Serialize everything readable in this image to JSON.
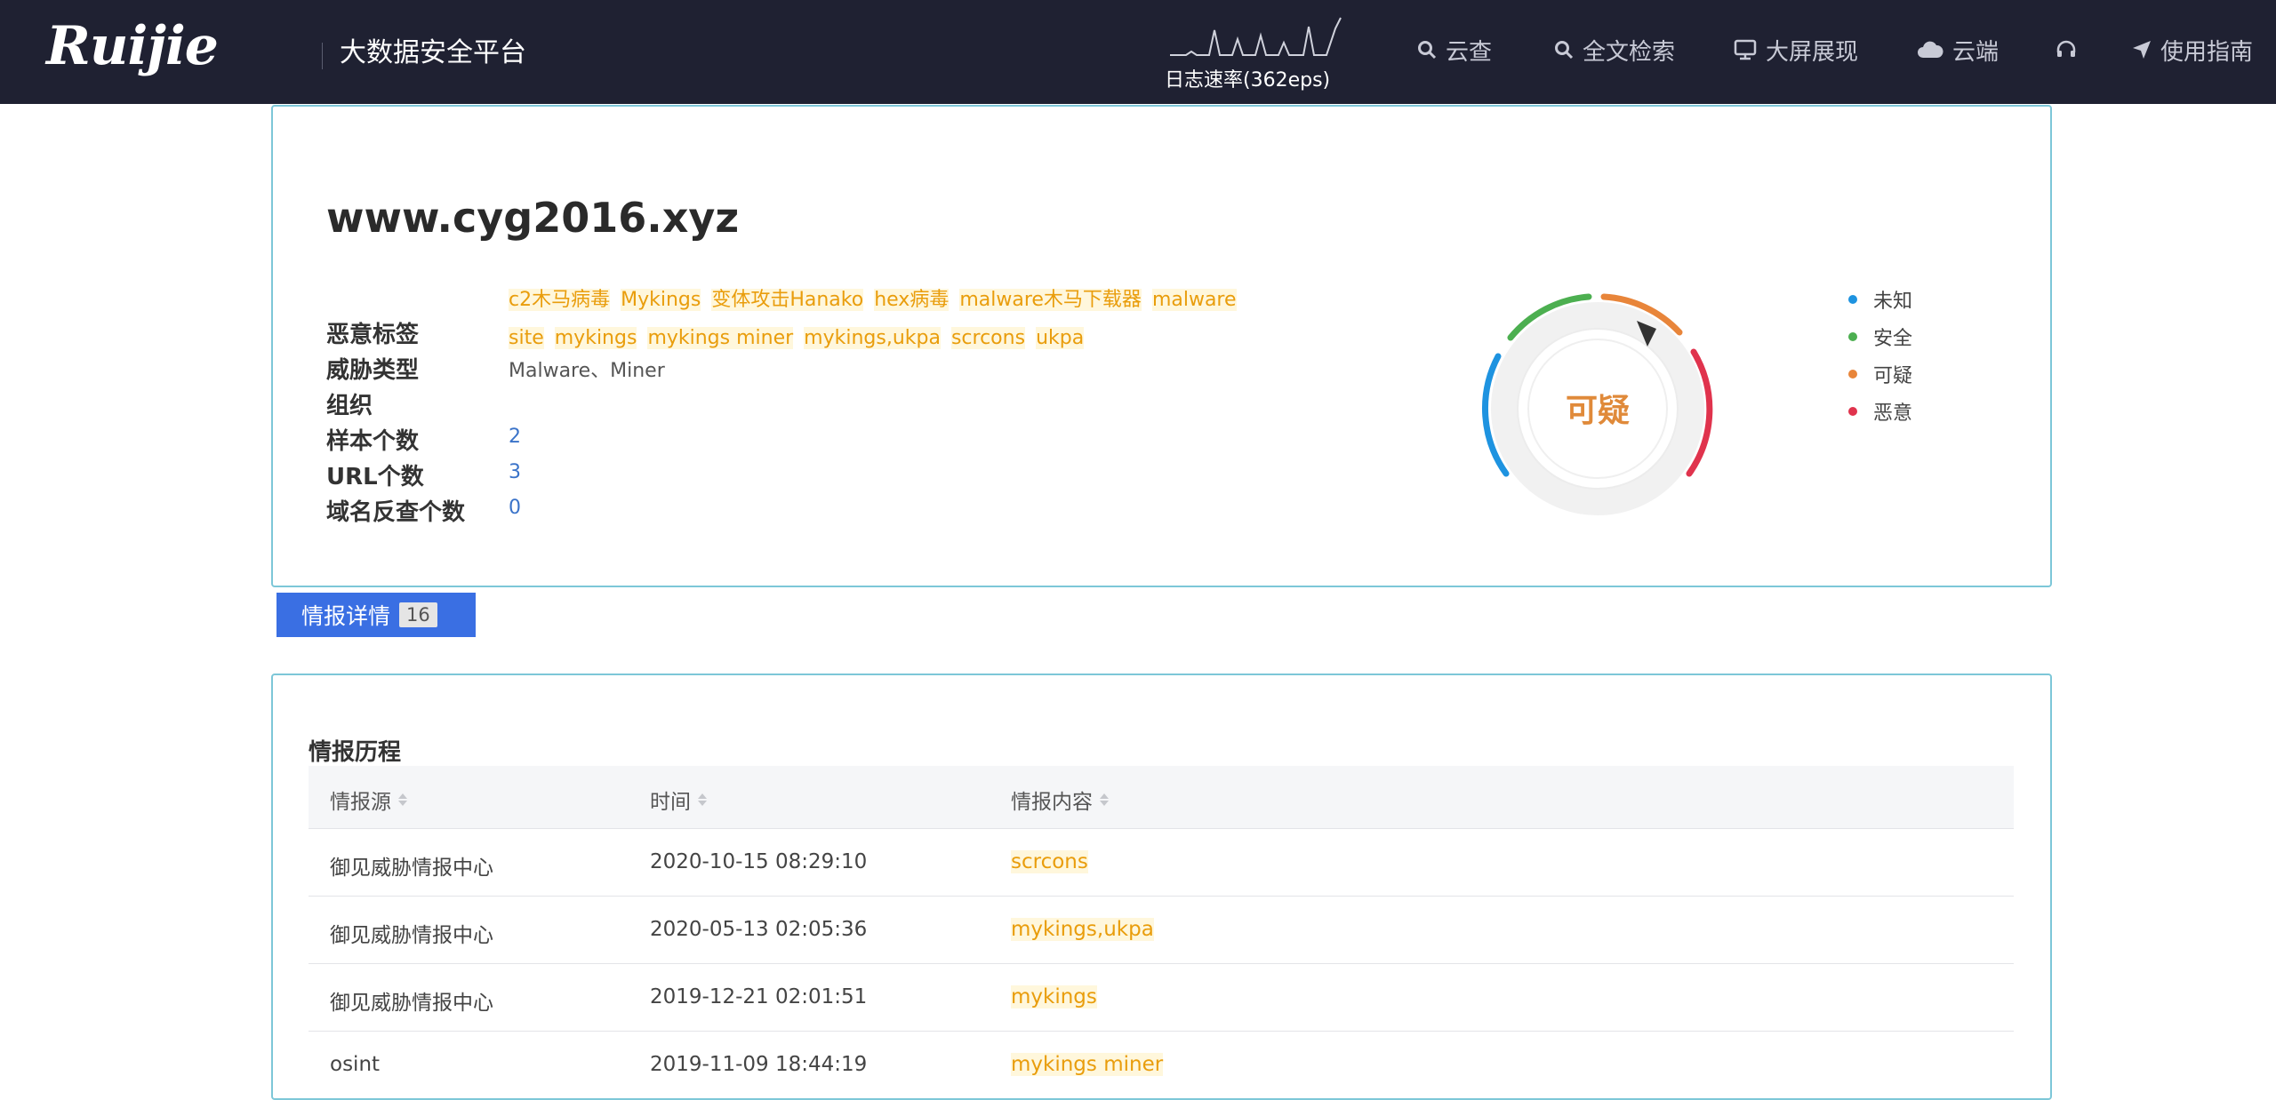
{
  "header": {
    "logo": "Ruijie",
    "platform_title": "大数据安全平台",
    "log_rate": "日志速率(362eps)",
    "nav": [
      {
        "icon": "search-icon",
        "label": "云查"
      },
      {
        "icon": "search-icon",
        "label": "全文检索"
      },
      {
        "icon": "monitor-icon",
        "label": "大屏展现"
      },
      {
        "icon": "cloud-icon",
        "label": "云端"
      },
      {
        "icon": "headset-icon",
        "label": ""
      },
      {
        "icon": "navigation-icon",
        "label": "使用指南"
      }
    ]
  },
  "intel": {
    "domain": "www.cyg2016.xyz",
    "tags": [
      "c2木马病毒",
      "Mykings",
      "变体攻击Hanako",
      "hex病毒",
      "malware木马下载器",
      "malware",
      "site",
      "mykings",
      "mykings miner",
      "mykings,ukpa",
      "scrcons",
      "ukpa"
    ],
    "fields": {
      "tags_label": "恶意标签",
      "threat_type_label": "威胁类型",
      "threat_type_value": "Malware、Miner",
      "org_label": "组织",
      "sample_label": "样本个数",
      "sample_value": "2",
      "url_label": "URL个数",
      "url_value": "3",
      "reverse_label": "域名反查个数",
      "reverse_value": "0"
    },
    "verdict": "可疑",
    "verdict_color": "#e08a3a",
    "legend": [
      {
        "label": "未知",
        "color": "#1e93e0"
      },
      {
        "label": "安全",
        "color": "#4caf50"
      },
      {
        "label": "可疑",
        "color": "#e8853a"
      },
      {
        "label": "恶意",
        "color": "#e0334d"
      }
    ]
  },
  "tab": {
    "label": "情报详情",
    "count": "16"
  },
  "history": {
    "title": "情报历程",
    "columns": [
      "情报源",
      "时间",
      "情报内容"
    ],
    "rows": [
      {
        "source": "御见威胁情报中心",
        "time": "2020-10-15 08:29:10",
        "content": "scrcons"
      },
      {
        "source": "御见威胁情报中心",
        "time": "2020-05-13 02:05:36",
        "content": "mykings,ukpa"
      },
      {
        "source": "御见威胁情报中心",
        "time": "2019-12-21 02:01:51",
        "content": "mykings"
      },
      {
        "source": "osint",
        "time": "2019-11-09 18:44:19",
        "content": "mykings miner"
      }
    ]
  }
}
